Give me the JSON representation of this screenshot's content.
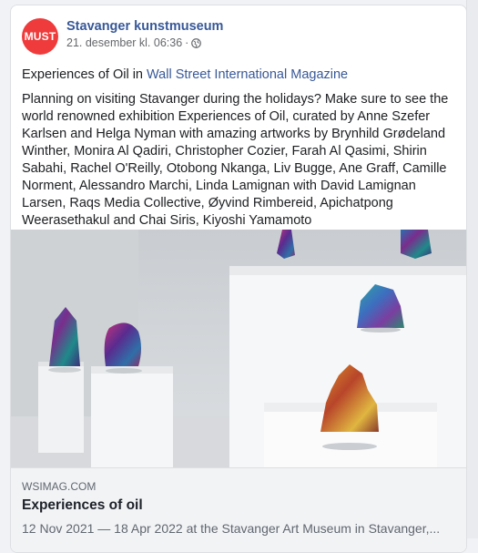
{
  "post": {
    "page_name": "Stavanger kunstmuseum",
    "avatar_text": "MUST",
    "timestamp": "21. desember kl. 06:36",
    "separator": "·",
    "privacy_icon": "globe-icon",
    "text_prefix": "Experiences of Oil in ",
    "text_link": "Wall Street International Magazine",
    "body": "Planning on visiting Stavanger during the holidays? Make sure to see the world renowned exhibition Experiences of Oil, curated by Anne Szefer Karlsen and Helga Nyman with amazing artworks by Brynhild Grødeland Winther, Monira Al Qadiri, Christopher Cozier, Farah Al Qasimi, Shirin Sabahi, Rachel O'Reilly, Otobong Nkanga, Liv Bugge, Ane Graff, Camille Norment, Alessandro Marchi, Linda Lamignan with David Lamignan Larsen, Raqs Media Collective, Øyvind Rimbereid, Apichatpong Weerasethakul and Chai Siris, Kiyoshi Yamamoto"
  },
  "link_preview": {
    "domain": "WSIMAG.COM",
    "title": "Experiences of oil",
    "description": "12 Nov 2021 — 18 Apr 2022 at the Stavanger Art Museum in Stavanger,..."
  },
  "colors": {
    "link": "#385898",
    "avatar": "#ef3b3b",
    "preview_bg": "#f2f3f5"
  }
}
